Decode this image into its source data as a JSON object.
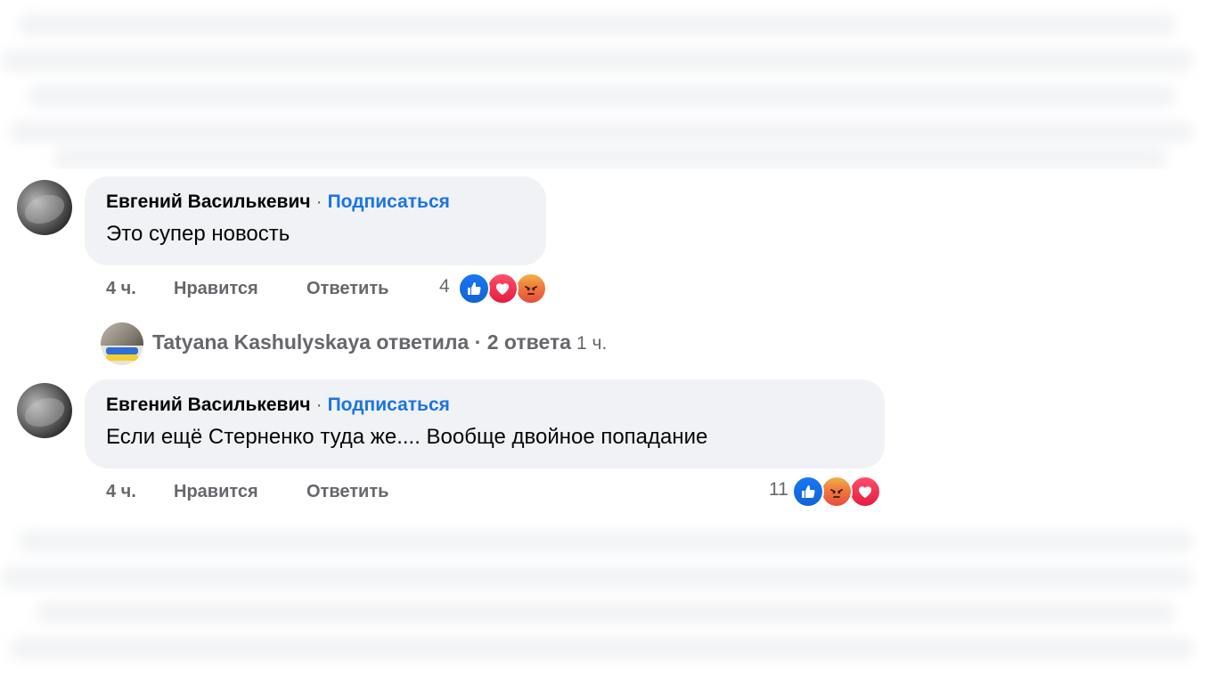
{
  "comments": [
    {
      "author": "Евгений Василькевич",
      "separator": "·",
      "subscribe": "Подписаться",
      "text": "Это супер новость",
      "time": "4 ч.",
      "like": "Нравится",
      "reply": "Ответить",
      "reaction_count": "4",
      "reactions": [
        "like-icon",
        "love-icon",
        "angry-icon"
      ]
    },
    {
      "author": "Евгений Василькевич",
      "separator": "·",
      "subscribe": "Подписаться",
      "text": "Если ещё Стерненко туда же.... Вообще двойное попадание",
      "time": "4 ч.",
      "like": "Нравится",
      "reply": "Ответить",
      "reaction_count": "11",
      "reactions": [
        "like-icon",
        "angry-icon",
        "love-icon"
      ]
    }
  ],
  "replies_summary": {
    "text": "Tatyana Kashulyskaya ответила · 2 ответа",
    "time": "1 ч."
  },
  "colors": {
    "bubble": "#f0f2f5",
    "link": "#1b74e4",
    "secondary_text": "#65676b",
    "like": "#1877f2",
    "love": "#e41e3f",
    "angry": "#ef7a3c"
  }
}
